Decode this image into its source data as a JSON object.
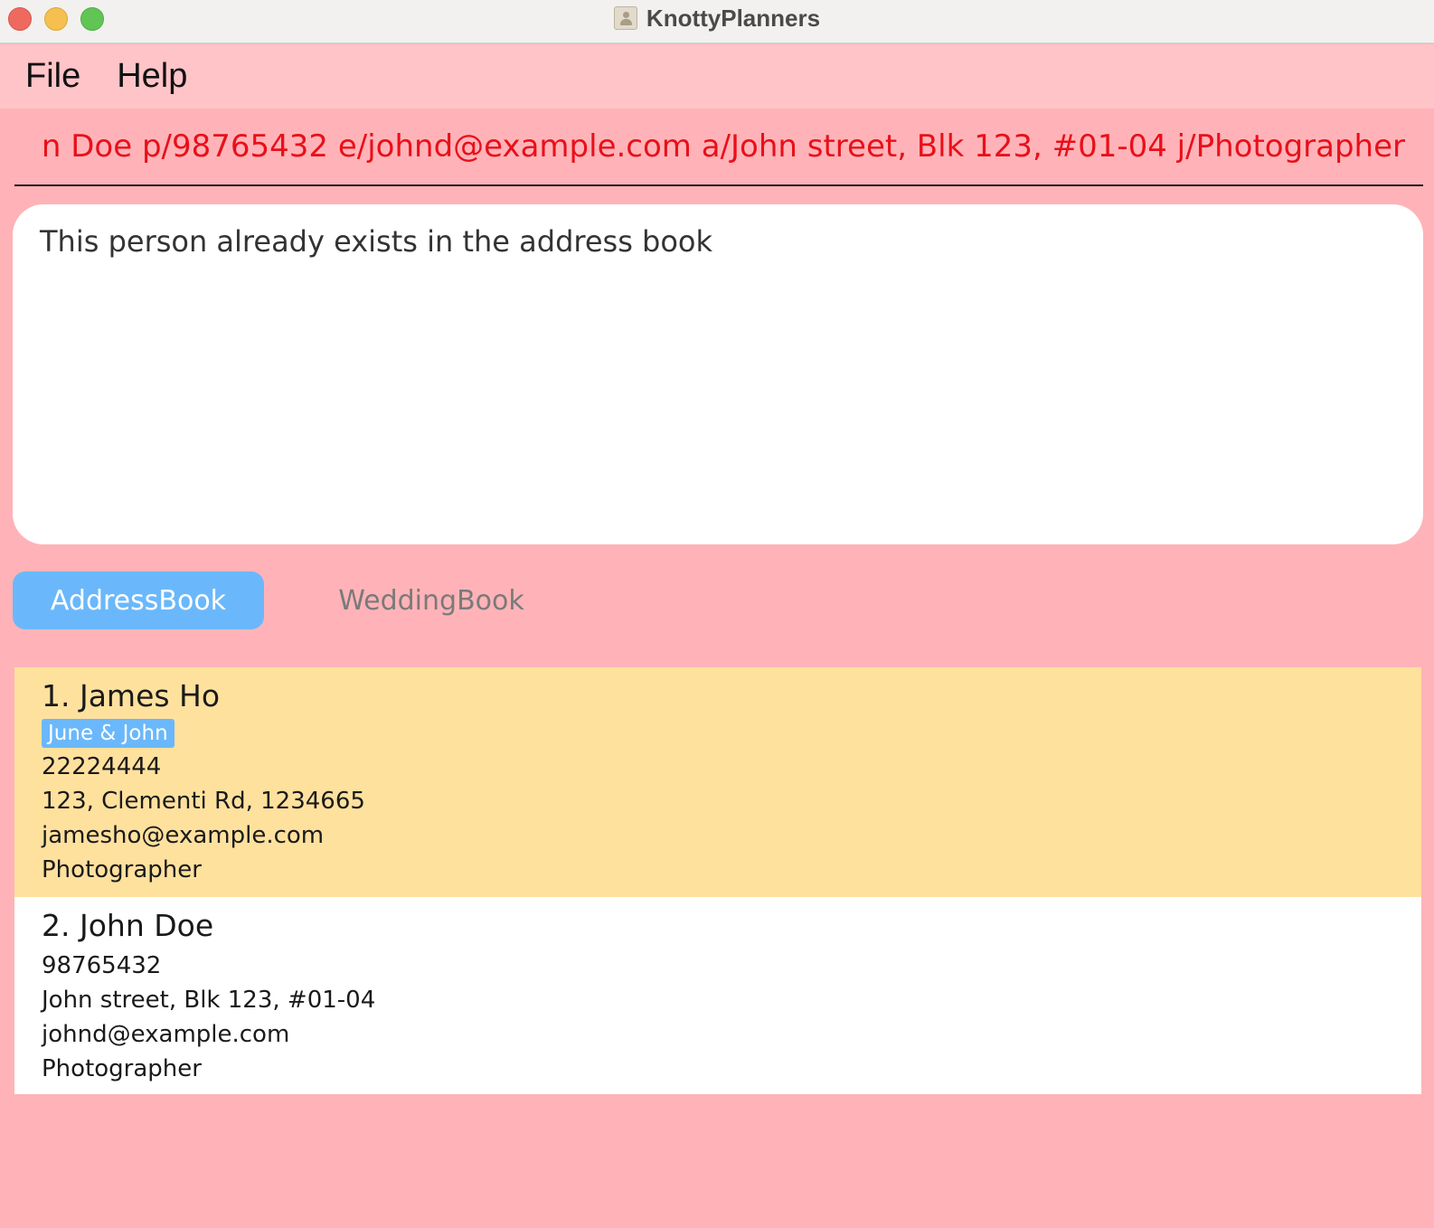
{
  "window": {
    "title": "KnottyPlanners",
    "icon": "address-book-icon"
  },
  "menu": {
    "file": "File",
    "help": "Help"
  },
  "command": {
    "value": "n Doe p/98765432 e/johnd@example.com a/John street, Blk 123, #01-04 j/Photographer",
    "color": "#e8101a"
  },
  "result": {
    "message": "This person already exists in the address book"
  },
  "tabs": [
    {
      "label": "AddressBook",
      "active": true
    },
    {
      "label": "WeddingBook",
      "active": false
    }
  ],
  "persons": [
    {
      "name": "1. James Ho",
      "tag": "June & John",
      "phone": "22224444",
      "address": "123, Clementi Rd, 1234665",
      "email": "jamesho@example.com",
      "job": "Photographer"
    },
    {
      "name": "2. John Doe",
      "phone": "98765432",
      "address": "John street, Blk 123, #01-04",
      "email": "johnd@example.com",
      "job": "Photographer"
    }
  ],
  "colors": {
    "background": "#ffb3b8",
    "menubar": "#ffc4c8",
    "accent": "#6ab8fb",
    "selected_card": "#ffe19e"
  }
}
